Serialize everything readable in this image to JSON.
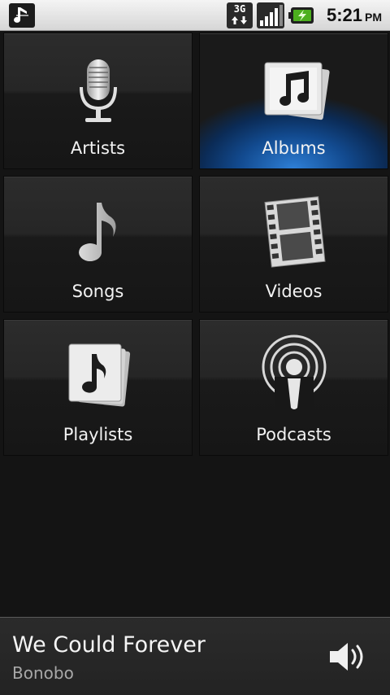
{
  "status_bar": {
    "network_type": "3G",
    "time": "5:21",
    "ampm": "PM"
  },
  "tiles": [
    {
      "label": "Artists",
      "icon": "microphone-icon"
    },
    {
      "label": "Albums",
      "icon": "album-icon",
      "selected": true
    },
    {
      "label": "Songs",
      "icon": "music-note-icon"
    },
    {
      "label": "Videos",
      "icon": "film-strip-icon"
    },
    {
      "label": "Playlists",
      "icon": "playlist-icon"
    },
    {
      "label": "Podcasts",
      "icon": "podcast-icon"
    }
  ],
  "now_playing": {
    "title": "We Could Forever",
    "artist": "Bonobo",
    "icon": "speaker-icon"
  },
  "colors": {
    "selected_tile": "#2e7fd6",
    "background": "#141414"
  }
}
